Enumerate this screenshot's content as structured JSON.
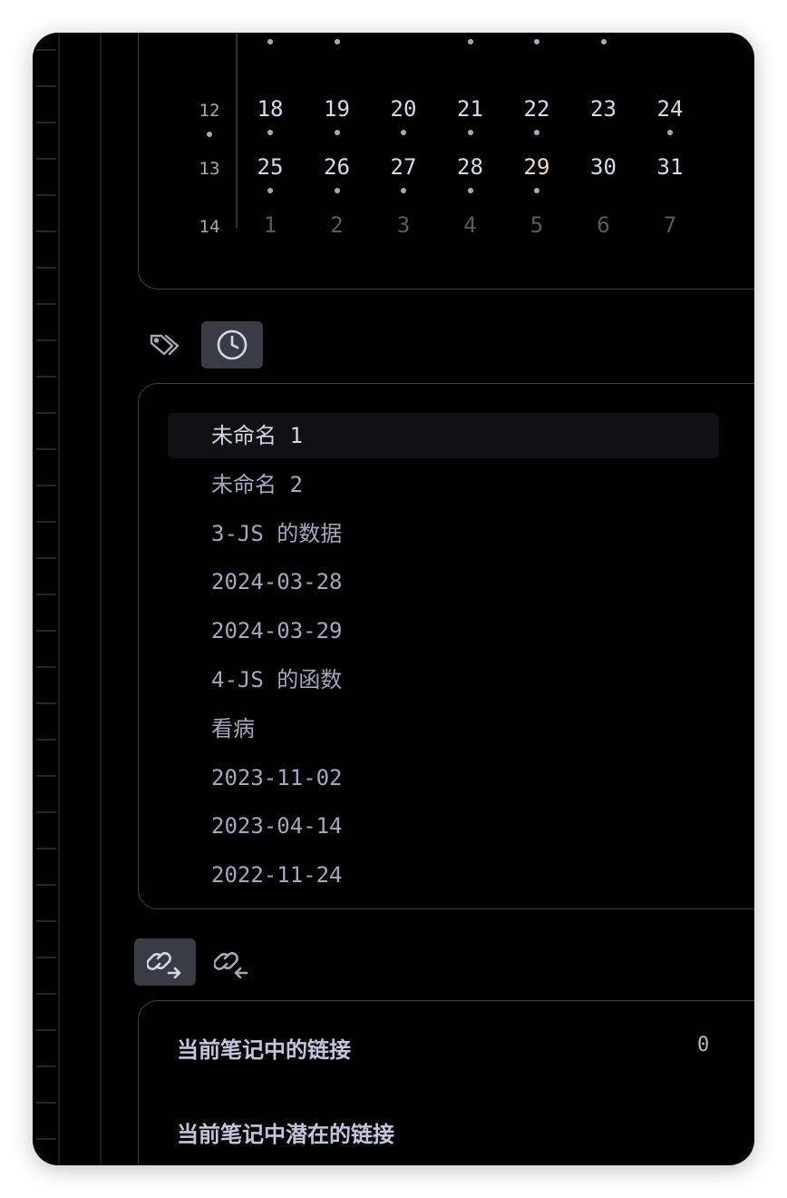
{
  "calendar": {
    "rows": [
      {
        "week": "",
        "days": [
          {
            "label": "",
            "kind": "cur",
            "dot": true
          },
          {
            "label": "",
            "kind": "cur",
            "dot": true
          },
          {
            "label": "",
            "kind": "cur",
            "dot": false
          },
          {
            "label": "",
            "kind": "cur",
            "dot": true
          },
          {
            "label": "",
            "kind": "cur",
            "dot": true
          },
          {
            "label": "",
            "kind": "cur",
            "dot": true
          },
          {
            "label": "",
            "kind": "cur",
            "dot": false
          }
        ],
        "week_dot": false
      },
      {
        "week": "12",
        "week_dot": true,
        "days": [
          {
            "label": "18",
            "kind": "cur",
            "dot": true
          },
          {
            "label": "19",
            "kind": "cur",
            "dot": true
          },
          {
            "label": "20",
            "kind": "cur",
            "dot": true
          },
          {
            "label": "21",
            "kind": "cur",
            "dot": true
          },
          {
            "label": "22",
            "kind": "cur",
            "dot": true
          },
          {
            "label": "23",
            "kind": "cur",
            "dot": false
          },
          {
            "label": "24",
            "kind": "cur",
            "dot": true
          }
        ]
      },
      {
        "week": "13",
        "week_dot": false,
        "days": [
          {
            "label": "25",
            "kind": "cur",
            "dot": true
          },
          {
            "label": "26",
            "kind": "cur",
            "dot": true
          },
          {
            "label": "27",
            "kind": "cur",
            "dot": true
          },
          {
            "label": "28",
            "kind": "cur",
            "dot": true
          },
          {
            "label": "29",
            "kind": "today",
            "dot": true
          },
          {
            "label": "30",
            "kind": "cur",
            "dot": false
          },
          {
            "label": "31",
            "kind": "cur",
            "dot": false
          }
        ]
      },
      {
        "week": "14",
        "week_dot": false,
        "days": [
          {
            "label": "1",
            "kind": "other",
            "dot": false
          },
          {
            "label": "2",
            "kind": "other",
            "dot": false
          },
          {
            "label": "3",
            "kind": "other",
            "dot": false
          },
          {
            "label": "4",
            "kind": "other",
            "dot": false
          },
          {
            "label": "5",
            "kind": "other",
            "dot": false
          },
          {
            "label": "6",
            "kind": "other",
            "dot": false
          },
          {
            "label": "7",
            "kind": "other",
            "dot": false
          }
        ]
      }
    ]
  },
  "view_tabs": [
    {
      "icon": "tags-icon",
      "active": false
    },
    {
      "icon": "clock-icon",
      "active": true
    }
  ],
  "recent": {
    "items": [
      "未命名 1",
      "未命名 2",
      "3-JS 的数据",
      "2024-03-28",
      "2024-03-29",
      "4-JS 的函数",
      "看病",
      "2023-11-02",
      "2023-04-14",
      "2022-11-24"
    ],
    "selected_index": 0
  },
  "link_tabs": [
    {
      "icon": "outgoing-link-icon",
      "active": true
    },
    {
      "icon": "incoming-link-icon",
      "active": false
    }
  ],
  "links": {
    "current_label": "当前笔记中的链接",
    "current_count": "0",
    "potential_label": "当前笔记中潜在的链接"
  },
  "colors": {
    "background": "#000000",
    "card_border": "#3f3f46",
    "active_tab": "#3a3b45",
    "today": "#f1d8c7"
  }
}
